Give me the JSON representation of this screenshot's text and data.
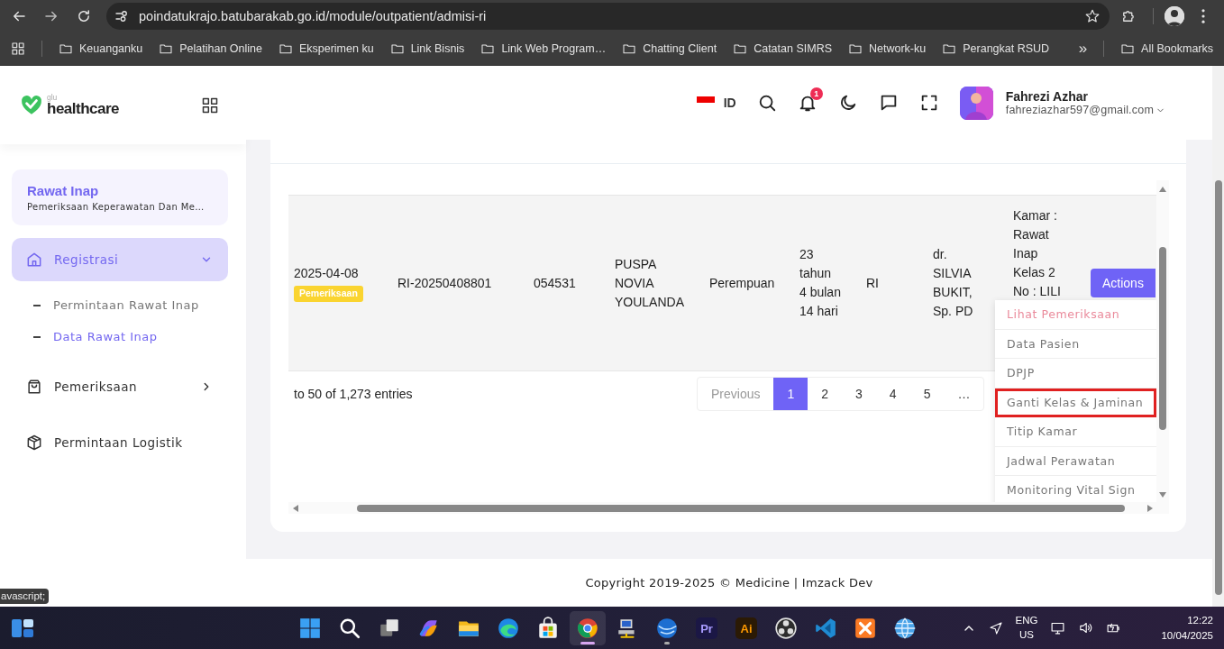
{
  "browser": {
    "url": "poindatukrajo.batubarakab.go.id/module/outpatient/admisi-ri",
    "bookmarks": [
      {
        "label": "Keuanganku"
      },
      {
        "label": "Pelatihan Online"
      },
      {
        "label": "Eksperimen ku"
      },
      {
        "label": "Link Bisnis"
      },
      {
        "label": "Link Web Program…"
      },
      {
        "label": "Chatting Client"
      },
      {
        "label": "Catatan SIMRS"
      },
      {
        "label": "Network-ku"
      },
      {
        "label": "Perangkat RSUD"
      }
    ],
    "more": "»",
    "all_bookmarks": "All Bookmarks"
  },
  "sidebar": {
    "logo": {
      "small": "glu",
      "name": "healthcare"
    },
    "module": {
      "title": "Rawat Inap",
      "subtitle": "Pemeriksaan Keperawatan Dan Me…"
    },
    "menu": [
      {
        "label": "Registrasi",
        "selected": true,
        "expanded": true,
        "children": [
          {
            "label": "Permintaan Rawat Inap",
            "selected": false
          },
          {
            "label": "Data Rawat Inap",
            "selected": true
          }
        ]
      },
      {
        "label": "Pemeriksaan",
        "selected": false,
        "expanded": false
      },
      {
        "label": "Permintaan Logistik",
        "selected": false
      }
    ]
  },
  "header": {
    "language": "ID",
    "notifications": "1",
    "user": {
      "name": "Fahrezi Azhar",
      "email": "fahreziazhar597@gmail.com"
    }
  },
  "table": {
    "rows": [
      {
        "cells": [
          {
            "text": "2025-04-08",
            "badge": "Pemeriksaan"
          },
          {
            "text": "RI-20250408801"
          },
          {
            "text": "054531"
          },
          {
            "lines": [
              "PUSPA",
              "NOVIA",
              "YOULANDA"
            ]
          },
          {
            "text": "Perempuan"
          },
          {
            "lines": [
              "23",
              "tahun",
              "4 bulan",
              "14 hari"
            ]
          },
          {
            "text": "RI"
          },
          {
            "lines": [
              "dr.",
              "SILVIA",
              "BUKIT,",
              "Sp. PD"
            ]
          },
          {
            "lines": [
              "Kamar :",
              "Rawat",
              "Inap",
              "Kelas 2",
              "No : LILI"
            ]
          }
        ],
        "action": "Actions"
      }
    ],
    "info": "to 50 of 1,273 entries",
    "pagination": {
      "previous": {
        "label": "Previous",
        "disabled": true
      },
      "pages": [
        {
          "label": "1",
          "selected": true
        },
        {
          "label": "2",
          "selected": false
        },
        {
          "label": "3",
          "selected": false
        },
        {
          "label": "4",
          "selected": false
        },
        {
          "label": "5",
          "selected": false
        },
        {
          "label": "…",
          "selected": false
        }
      ]
    },
    "action_menu": [
      {
        "label": "Lihat Pemeriksaan",
        "active": true,
        "outlined": false
      },
      {
        "label": "Data Pasien",
        "active": false,
        "outlined": false
      },
      {
        "label": "DPJP",
        "active": false,
        "outlined": false
      },
      {
        "label": "Ganti Kelas & Jaminan",
        "active": false,
        "outlined": true
      },
      {
        "label": "Titip Kamar",
        "active": false,
        "outlined": false
      },
      {
        "label": "Jadwal Perawatan",
        "active": false,
        "outlined": false
      },
      {
        "label": "Monitoring Vital Sign",
        "active": false,
        "outlined": false
      }
    ]
  },
  "footer": "Copyright 2019-2025 © Medicine | Imzack Dev",
  "status_tooltip": "avascript;",
  "taskbar": {
    "apps": [
      {
        "running": false,
        "selected": false
      },
      {
        "running": false,
        "selected": false
      },
      {
        "running": false,
        "selected": false
      },
      {
        "running": false,
        "selected": false
      },
      {
        "running": false,
        "selected": false
      },
      {
        "running": false,
        "selected": false
      },
      {
        "running": false,
        "selected": false
      },
      {
        "running": true,
        "selected": true
      },
      {
        "running": false,
        "selected": false
      },
      {
        "running": true,
        "selected": false
      },
      {
        "label": "Pr",
        "running": false,
        "selected": false
      },
      {
        "label": "Ai",
        "running": false,
        "selected": false
      },
      {
        "running": false,
        "selected": false
      },
      {
        "running": false,
        "selected": false
      },
      {
        "running": false,
        "selected": false
      },
      {
        "running": false,
        "selected": false
      }
    ],
    "language": "ENG",
    "region": "US",
    "time": "12:22",
    "date": "10/04/2025"
  }
}
